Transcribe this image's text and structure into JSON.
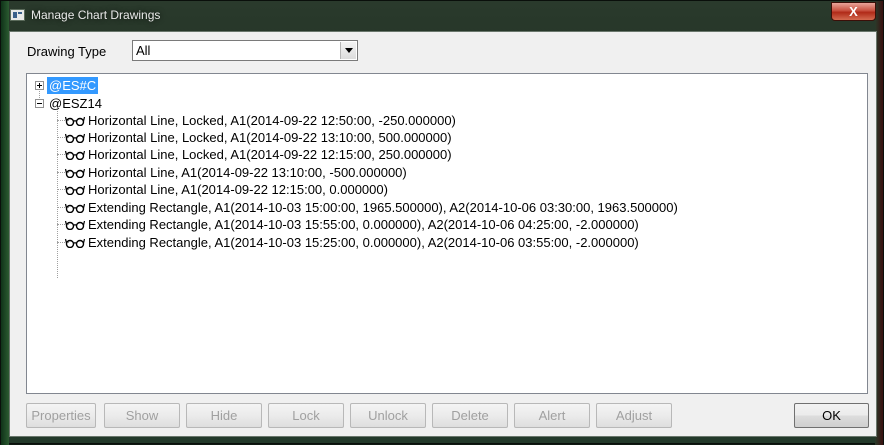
{
  "window": {
    "title": "Manage Chart Drawings",
    "close_glyph": "X"
  },
  "filter": {
    "label": "Drawing Type",
    "selected": "All"
  },
  "tree": {
    "nodes": [
      {
        "label": "@ES#C",
        "expanded": false,
        "selected": true
      },
      {
        "label": "@ESZ14",
        "expanded": true,
        "selected": false,
        "children": [
          "Horizontal Line, Locked, A1(2014-09-22  12:50:00, -250.000000)",
          "Horizontal Line, Locked, A1(2014-09-22  13:10:00, 500.000000)",
          "Horizontal Line, Locked, A1(2014-09-22  12:15:00, 250.000000)",
          "Horizontal Line, A1(2014-09-22  13:10:00, -500.000000)",
          "Horizontal Line, A1(2014-09-22  12:15:00, 0.000000)",
          "Extending Rectangle, A1(2014-10-03  15:00:00, 1965.500000), A2(2014-10-06  03:30:00, 1963.500000)",
          "Extending Rectangle, A1(2014-10-03  15:55:00, 0.000000), A2(2014-10-06  04:25:00, -2.000000)",
          "Extending Rectangle, A1(2014-10-03  15:25:00, 0.000000), A2(2014-10-06  03:55:00, -2.000000)"
        ]
      }
    ]
  },
  "buttons": {
    "properties": "Properties",
    "show": "Show",
    "hide": "Hide",
    "lock": "Lock",
    "unlock": "Unlock",
    "delete": "Delete",
    "alert": "Alert",
    "adjust": "Adjust",
    "ok": "OK"
  },
  "colors": {
    "selection": "#3399ff",
    "close_button": "#c8503f"
  }
}
